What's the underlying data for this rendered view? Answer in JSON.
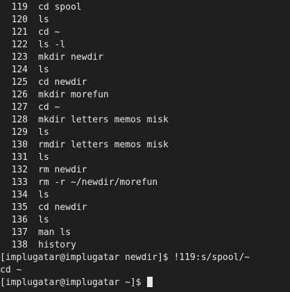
{
  "history": [
    {
      "num": "119",
      "cmd": "cd spool"
    },
    {
      "num": "120",
      "cmd": "ls"
    },
    {
      "num": "121",
      "cmd": "cd ~"
    },
    {
      "num": "122",
      "cmd": "ls -l"
    },
    {
      "num": "123",
      "cmd": "mkdir newdir"
    },
    {
      "num": "124",
      "cmd": "ls"
    },
    {
      "num": "125",
      "cmd": "cd newdir"
    },
    {
      "num": "126",
      "cmd": "mkdir morefun"
    },
    {
      "num": "127",
      "cmd": "cd ~"
    },
    {
      "num": "128",
      "cmd": "mkdir letters memos misk"
    },
    {
      "num": "129",
      "cmd": "ls"
    },
    {
      "num": "130",
      "cmd": "rmdir letters memos misk"
    },
    {
      "num": "131",
      "cmd": "ls"
    },
    {
      "num": "132",
      "cmd": "rm newdir"
    },
    {
      "num": "133",
      "cmd": "rm -r ~/newdir/morefun"
    },
    {
      "num": "134",
      "cmd": "ls"
    },
    {
      "num": "135",
      "cmd": "cd newdir"
    },
    {
      "num": "136",
      "cmd": "ls"
    },
    {
      "num": "137",
      "cmd": "man ls"
    },
    {
      "num": "138",
      "cmd": "history"
    }
  ],
  "prompt1": {
    "prompt": "[implugatar@implugatar newdir]$ ",
    "command": "!119:s/spool/~"
  },
  "output": "cd ~",
  "prompt2": {
    "prompt": "[implugatar@implugatar ~]$ "
  },
  "colors": {
    "background": "#1e1f21",
    "foreground": "#e6e6e6"
  }
}
